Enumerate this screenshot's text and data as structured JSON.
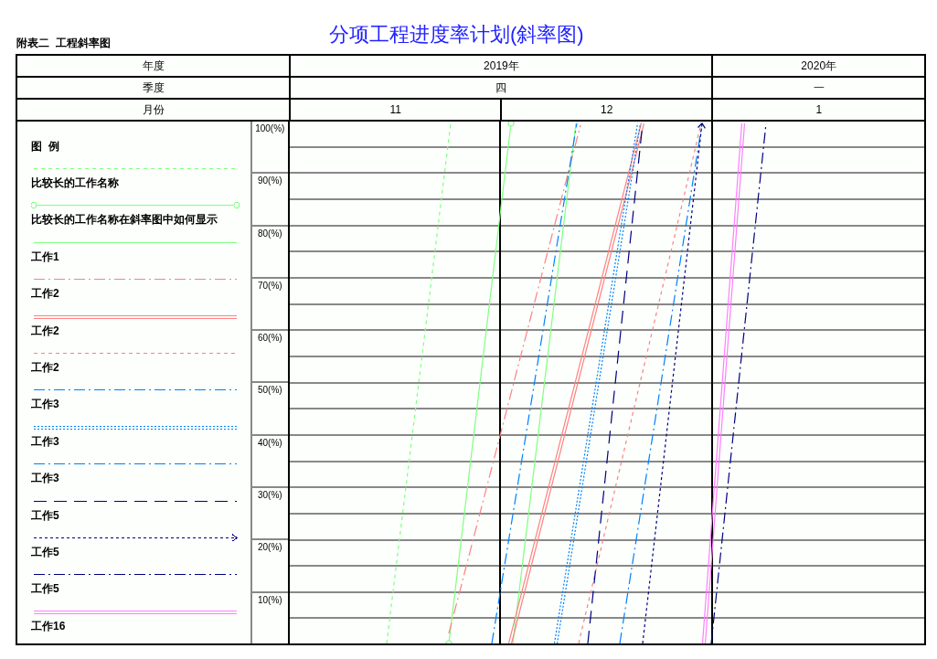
{
  "subtitle": "附表二  工程斜率图",
  "title": "分项工程进度率计划(斜率图)",
  "row_labels": [
    "年度",
    "季度",
    "月份"
  ],
  "years": [
    {
      "label": "2019年",
      "quarters": [
        {
          "label": "四",
          "months": [
            "11",
            "12"
          ]
        }
      ]
    },
    {
      "label": "2020年",
      "quarters": [
        {
          "label": "一",
          "months": [
            "1"
          ]
        }
      ]
    }
  ],
  "legend": {
    "title": "图  例",
    "items": [
      {
        "name": "比较长的工作名称",
        "kind": "dashed",
        "color": "#80ff80"
      },
      {
        "name": "比较长的工作名称在斜率图中如何显示",
        "kind": "circles",
        "color": "#80ff80"
      },
      {
        "name": "工作1",
        "kind": "solid",
        "color": "#80ff80"
      },
      {
        "name": "工作2",
        "kind": "dashdot",
        "color": "#ff8080"
      },
      {
        "name": "工作2",
        "kind": "double",
        "color": "#ff8080"
      },
      {
        "name": "工作2",
        "kind": "dashed",
        "color": "#ff8080"
      },
      {
        "name": "工作3",
        "kind": "dashdot",
        "color": "#0080ff"
      },
      {
        "name": "工作3",
        "kind": "dotted-double",
        "color": "#0080ff"
      },
      {
        "name": "工作3",
        "kind": "dashdot",
        "color": "#0080ff"
      },
      {
        "name": "工作5",
        "kind": "longdash",
        "color": "#000080"
      },
      {
        "name": "工作5",
        "kind": "arrow",
        "color": "#000080"
      },
      {
        "name": "工作5",
        "kind": "dashdot",
        "color": "#000080"
      },
      {
        "name": "工作16",
        "kind": "double",
        "color": "#ff80ff"
      }
    ]
  },
  "y_ticks": [
    "100(%)",
    "90(%)",
    "80(%)",
    "70(%)",
    "60(%)",
    "50(%)",
    "40(%)",
    "30(%)",
    "20(%)",
    "10(%)"
  ]
}
